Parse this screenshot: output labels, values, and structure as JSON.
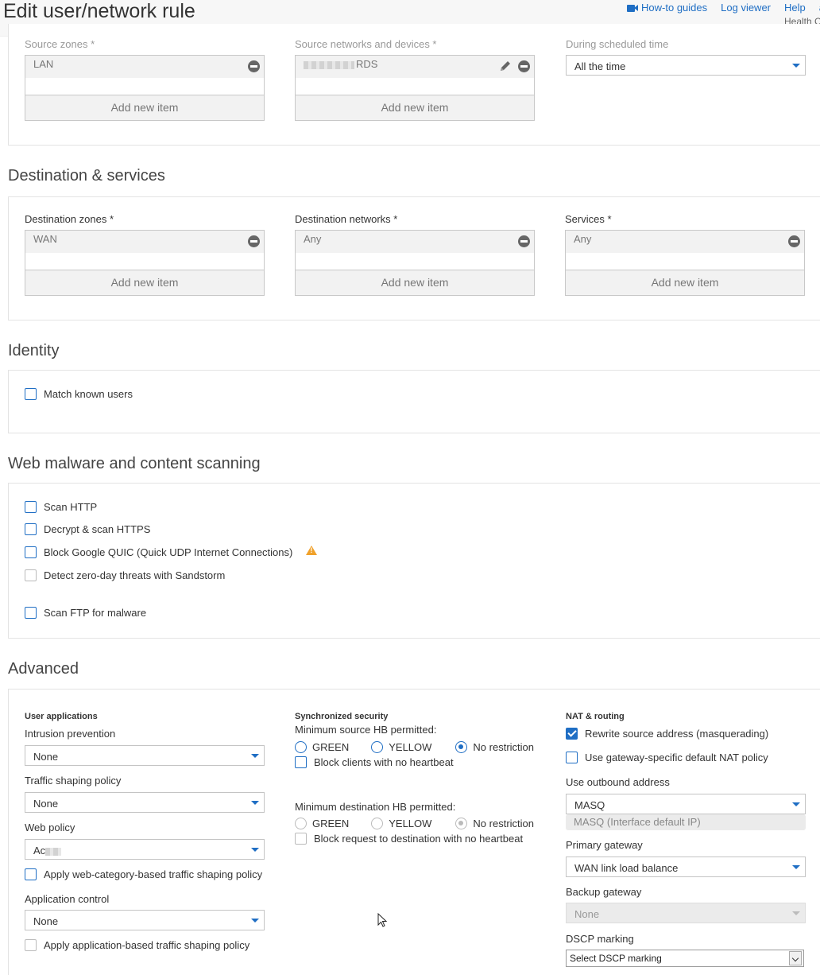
{
  "header": {
    "title": "Edit user/network rule",
    "links": {
      "howto": "How-to guides",
      "logviewer": "Log viewer",
      "help": "Help",
      "user": "a"
    },
    "subtitle": "Health C"
  },
  "source": {
    "zones_label": "Source zones *",
    "zones_item": "LAN",
    "networks_label": "Source networks and devices *",
    "networks_item_suffix": "RDS",
    "schedule_label": "During scheduled time",
    "schedule_value": "All the time",
    "add_new": "Add new item"
  },
  "destination": {
    "section_title": "Destination & services",
    "zones_label": "Destination zones *",
    "zones_item": "WAN",
    "networks_label": "Destination networks *",
    "networks_item": "Any",
    "services_label": "Services *",
    "services_item": "Any",
    "add_new": "Add new item"
  },
  "identity": {
    "section_title": "Identity",
    "match_known_users": "Match known users"
  },
  "scanning": {
    "section_title": "Web malware and content scanning",
    "scan_http": "Scan HTTP",
    "decrypt_https": "Decrypt & scan HTTPS",
    "block_quic": "Block Google QUIC (Quick UDP Internet Connections)",
    "sandstorm": "Detect zero-day threats with Sandstorm",
    "scan_ftp": "Scan FTP for malware"
  },
  "advanced": {
    "section_title": "Advanced",
    "user_apps": {
      "heading": "User applications",
      "ips_label": "Intrusion prevention",
      "ips_value": "None",
      "shaping_label": "Traffic shaping policy",
      "shaping_value": "None",
      "web_policy_label": "Web policy",
      "web_policy_value": "Ac",
      "web_cat_shaping": "Apply web-category-based traffic shaping policy",
      "app_control_label": "Application control",
      "app_control_value": "None",
      "app_shaping": "Apply application-based traffic shaping policy"
    },
    "sync_security": {
      "heading": "Synchronized security",
      "min_source_label": "Minimum source HB permitted:",
      "green": "GREEN",
      "yellow": "YELLOW",
      "no_restriction": "No restriction",
      "block_clients": "Block clients with no heartbeat",
      "min_dest_label": "Minimum destination HB permitted:",
      "block_request": "Block request to destination with no heartbeat"
    },
    "nat": {
      "heading": "NAT & routing",
      "rewrite_source": "Rewrite source address (masquerading)",
      "gateway_nat": "Use gateway-specific default NAT policy",
      "outbound_label": "Use outbound address",
      "outbound_value": "MASQ",
      "outbound_hint": "MASQ (Interface default IP)",
      "primary_gw_label": "Primary gateway",
      "primary_gw_value": "WAN link load balance",
      "backup_gw_label": "Backup gateway",
      "backup_gw_value": "None",
      "dscp_label": "DSCP marking",
      "dscp_value": "Select DSCP marking"
    }
  },
  "colors": {
    "accent": "#1f6ec4",
    "warning": "#f0a12a",
    "panel_border": "#e3e3e3"
  }
}
